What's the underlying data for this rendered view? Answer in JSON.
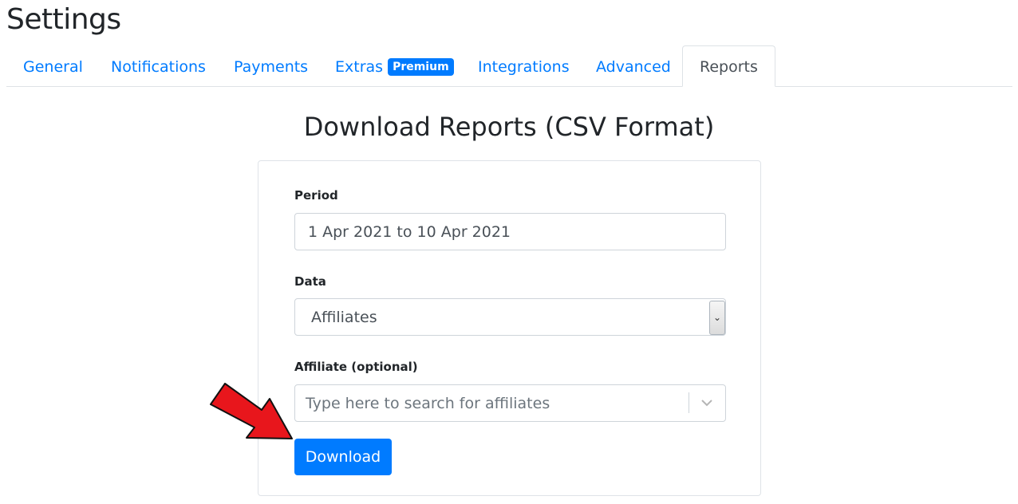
{
  "page": {
    "title": "Settings"
  },
  "tabs": [
    {
      "label": "General"
    },
    {
      "label": "Notifications"
    },
    {
      "label": "Payments"
    },
    {
      "label": "Extras",
      "badge": "Premium"
    },
    {
      "label": "Integrations"
    },
    {
      "label": "Advanced"
    },
    {
      "label": "Reports",
      "active": true
    }
  ],
  "reports": {
    "heading": "Download Reports (CSV Format)",
    "period": {
      "label": "Period",
      "value": "1 Apr 2021 to 10 Apr 2021"
    },
    "data": {
      "label": "Data",
      "selected": "Affiliates"
    },
    "affiliate": {
      "label": "Affiliate (optional)",
      "placeholder": "Type here to search for affiliates"
    },
    "download_label": "Download"
  },
  "colors": {
    "accent": "#007bff",
    "arrow": "#e8161c"
  },
  "icons": {
    "select_arrow": "chevron-down-icon",
    "combo_chevron": "chevron-down-icon",
    "annotation": "red-arrow-icon"
  }
}
